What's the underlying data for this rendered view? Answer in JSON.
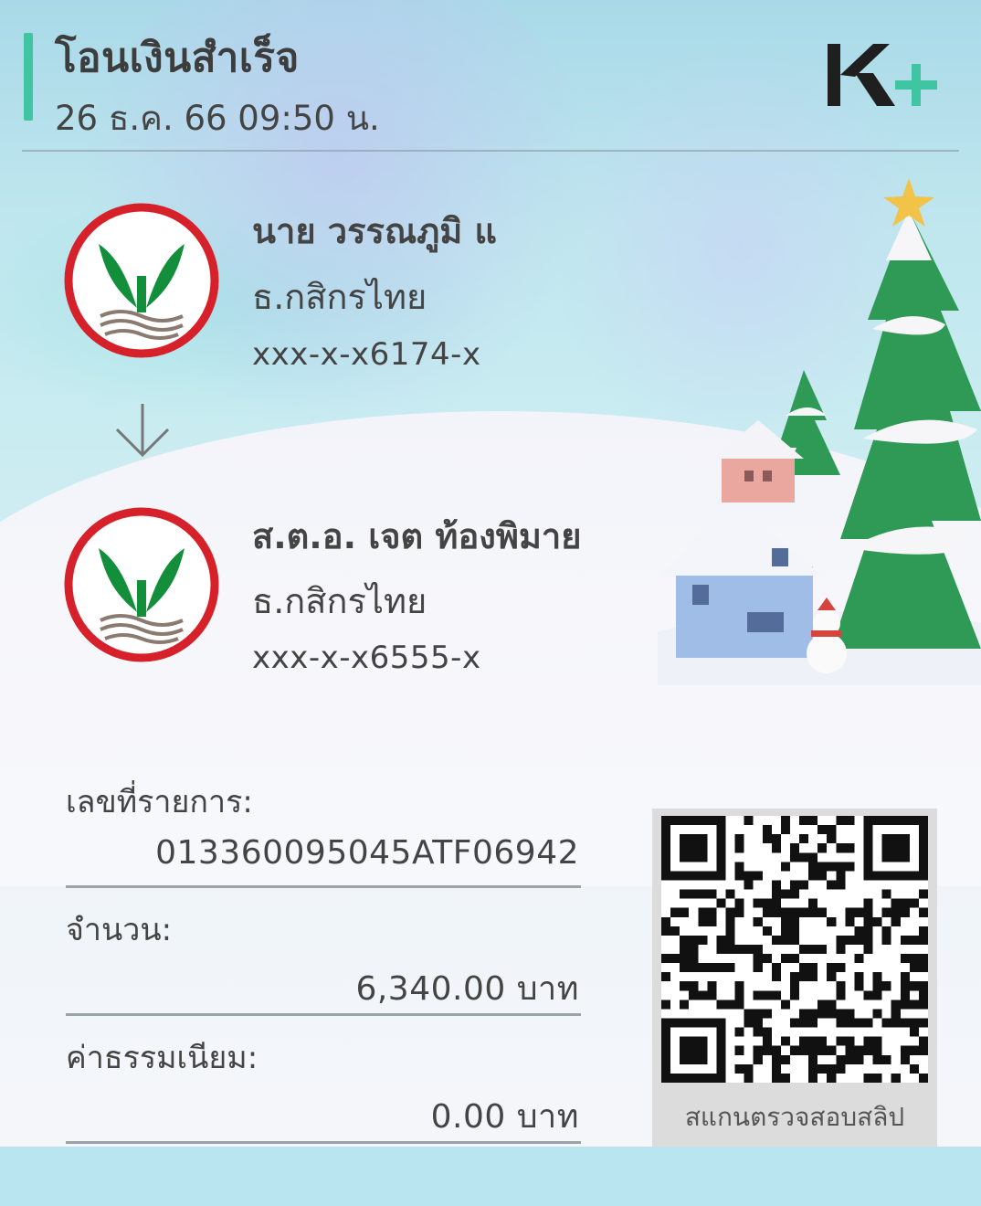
{
  "header": {
    "title": "โอนเงินสำเร็จ",
    "datetime": "26 ธ.ค. 66  09:50 น.",
    "logo_text": "K+"
  },
  "sender": {
    "name": "นาย วรรณภูมิ แ",
    "bank": "ธ.กสิกรไทย",
    "account": "xxx-x-x6174-x"
  },
  "receiver": {
    "name": "ส.ต.อ. เจต ท้องพิมาย",
    "bank": "ธ.กสิกรไทย",
    "account": "xxx-x-x6555-x"
  },
  "details": {
    "ref_label": "เลขที่รายการ:",
    "ref_value": "013360095045ATF06942",
    "amount_label": "จำนวน:",
    "amount_value": "6,340.00 บาท",
    "fee_label": "ค่าธรรมเนียม:",
    "fee_value": "0.00 บาท"
  },
  "qr": {
    "caption": "สแกนตรวจสอบสลิป"
  },
  "colors": {
    "accent": "#40c5a3",
    "kbank_green": "#138f3b",
    "kbank_red": "#d6202a",
    "text": "#444444",
    "bottom_bar": "#b8e5ef"
  },
  "icons": {
    "bank_logo": "kasikorn-logo-icon",
    "arrow": "arrow-down-icon"
  }
}
